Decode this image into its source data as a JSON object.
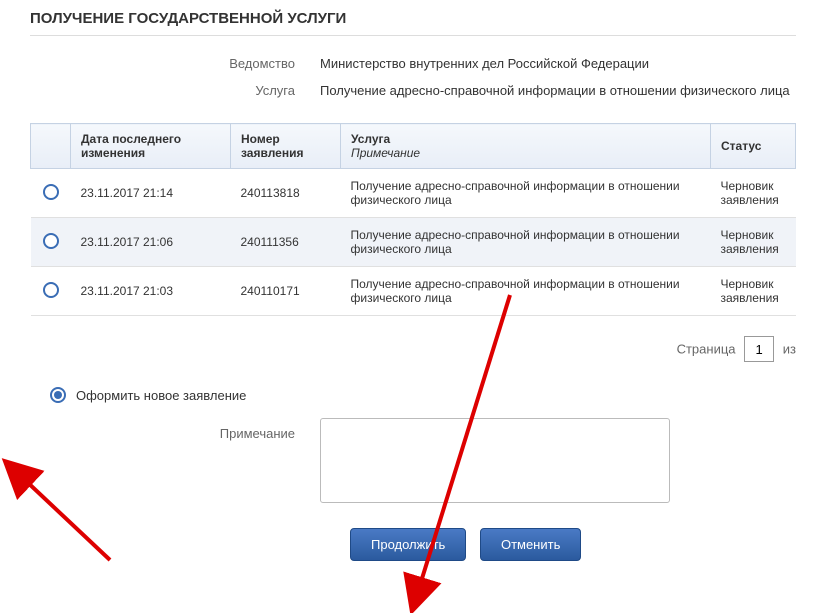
{
  "page_title": "ПОЛУЧЕНИЕ ГОСУДАРСТВЕННОЙ УСЛУГИ",
  "info": {
    "agency_label": "Ведомство",
    "agency_value": "Министерство внутренних дел Российской Федерации",
    "service_label": "Услуга",
    "service_value": "Получение адресно-справочной информации в отношении физического лица"
  },
  "table": {
    "headers": {
      "date": "Дата последнего изменения",
      "number": "Номер заявления",
      "service": "Услуга",
      "service_sub": "Примечание",
      "status": "Статус"
    },
    "rows": [
      {
        "date": "23.11.2017 21:14",
        "number": "240113818",
        "service": "Получение адресно-справочной информации в отношении физического лица",
        "status": "Черновик заявления"
      },
      {
        "date": "23.11.2017 21:06",
        "number": "240111356",
        "service": "Получение адресно-справочной информации в отношении физического лица",
        "status": "Черновик заявления"
      },
      {
        "date": "23.11.2017 21:03",
        "number": "240110171",
        "service": "Получение адресно-справочной информации в отношении физического лица",
        "status": "Черновик заявления"
      }
    ]
  },
  "pagination": {
    "label": "Страница",
    "current": "1",
    "of_label": "из"
  },
  "new_application": {
    "label": "Оформить новое заявление"
  },
  "note": {
    "label": "Примечание"
  },
  "buttons": {
    "continue": "Продолжить",
    "cancel": "Отменить"
  }
}
